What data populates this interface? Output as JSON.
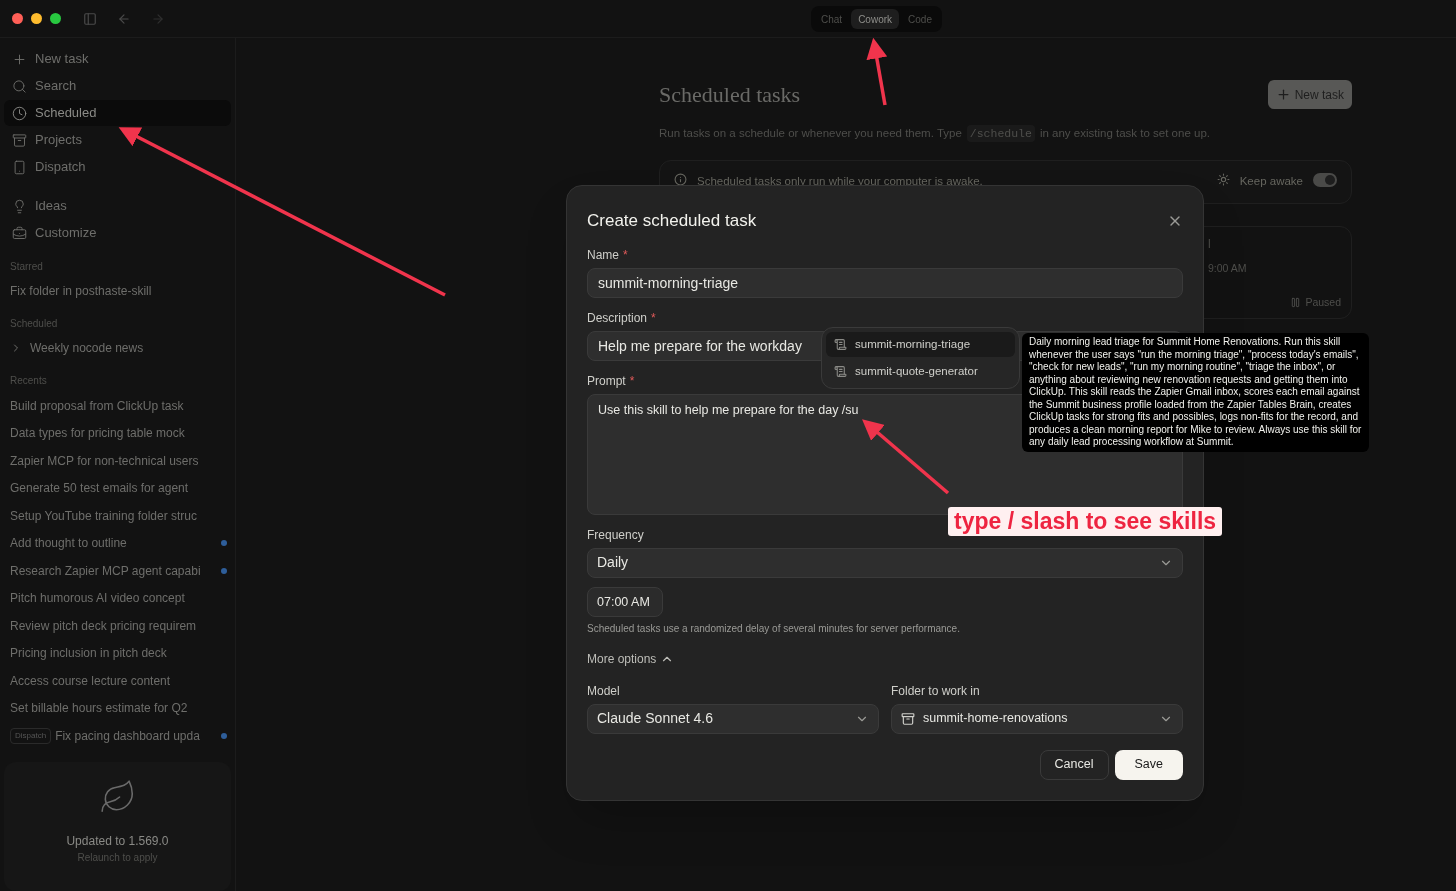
{
  "mode_tabs": [
    {
      "label": "Chat",
      "selected": false
    },
    {
      "label": "Cowork",
      "selected": true
    },
    {
      "label": "Code",
      "selected": false
    }
  ],
  "sidebar": {
    "nav_primary": [
      {
        "label": "New task",
        "selected": false
      },
      {
        "label": "Search",
        "selected": false
      },
      {
        "label": "Scheduled",
        "selected": true
      },
      {
        "label": "Projects",
        "selected": false
      },
      {
        "label": "Dispatch",
        "selected": false
      }
    ],
    "nav_secondary": [
      {
        "label": "Ideas",
        "selected": false
      },
      {
        "label": "Customize",
        "selected": false
      }
    ],
    "starred": {
      "title": "Starred",
      "items": [
        {
          "label": "Fix folder in posthaste-skill"
        }
      ]
    },
    "scheduled": {
      "title": "Scheduled",
      "items": [
        {
          "label": "Weekly nocode news",
          "expanded": false
        }
      ]
    },
    "recents": {
      "title": "Recents",
      "items": [
        {
          "label": "Build proposal from ClickUp task",
          "unread": false
        },
        {
          "label": "Data types for pricing table mock",
          "unread": false
        },
        {
          "label": "Zapier MCP for non-technical users",
          "unread": false
        },
        {
          "label": "Generate 50 test emails for agent",
          "unread": false
        },
        {
          "label": "Setup YouTube training folder struc",
          "unread": false
        },
        {
          "label": "Add thought to outline",
          "unread": true
        },
        {
          "label": "Research Zapier MCP agent capabi",
          "unread": true
        },
        {
          "label": "Pitch humorous AI video concept",
          "unread": false
        },
        {
          "label": "Review pitch deck pricing requirem",
          "unread": false
        },
        {
          "label": "Pricing inclusion in pitch deck",
          "unread": false
        },
        {
          "label": "Access course lecture content",
          "unread": false
        },
        {
          "label": "Set billable hours estimate for Q2",
          "unread": false
        },
        {
          "label": "Fix pacing dashboard upda",
          "unread": true,
          "badge": "Dispatch"
        }
      ]
    },
    "update_card": {
      "title": "Updated to 1.569.0",
      "subtitle": "Relaunch to apply"
    }
  },
  "main": {
    "title": "Scheduled tasks",
    "new_task_button": "New task",
    "description_before": "Run tasks on a schedule or whenever you need them. Type",
    "command": "/schedule",
    "description_after": "in any existing task to set one up.",
    "notice": {
      "text": "Scheduled tasks only run while your computer is awake.",
      "keep_awake": {
        "label": "Keep awake",
        "on": true
      }
    },
    "task_card": {
      "title": "l",
      "time": "9:00 AM",
      "status": "Paused"
    }
  },
  "dialog": {
    "title": "Create scheduled task",
    "name": {
      "label": "Name",
      "required_mark": "*",
      "value": "summit-morning-triage"
    },
    "description": {
      "label": "Description",
      "required_mark": "*",
      "value": "Help me prepare for the workday"
    },
    "prompt": {
      "label": "Prompt",
      "required_mark": "*",
      "value": "Use this skill to help me prepare for the day /su"
    },
    "frequency": {
      "label": "Frequency",
      "value": "Daily"
    },
    "time": {
      "value": "07:00 AM"
    },
    "hint": "Scheduled tasks use a randomized delay of several minutes for server performance.",
    "more_options": {
      "label": "More options",
      "expanded": true
    },
    "model": {
      "label": "Model",
      "value": "Claude Sonnet 4.6"
    },
    "folder": {
      "label": "Folder to work in",
      "value": "summit-home-renovations"
    },
    "buttons": {
      "cancel": "Cancel",
      "save": "Save"
    }
  },
  "skill_menu": {
    "items": [
      {
        "label": "summit-morning-triage",
        "selected": true
      },
      {
        "label": "summit-quote-generator",
        "selected": false
      }
    ],
    "tooltip": "Daily morning lead triage for Summit Home Renovations. Run this skill whenever the user says \"run the morning triage\", \"process today's emails\", \"check for new leads\", \"run my morning routine\", \"triage the inbox\", or anything about reviewing new renovation requests and getting them into ClickUp. This skill reads the Zapier Gmail inbox, scores each email against the Summit business profile loaded from the Zapier Tables Brain, creates ClickUp tasks for strong fits and possibles, logs non-fits for the record, and produces a clean morning report for Mike to review. Always use this skill for any daily lead processing workflow at Summit."
  },
  "annotation": {
    "text": "type / slash to see skills"
  }
}
